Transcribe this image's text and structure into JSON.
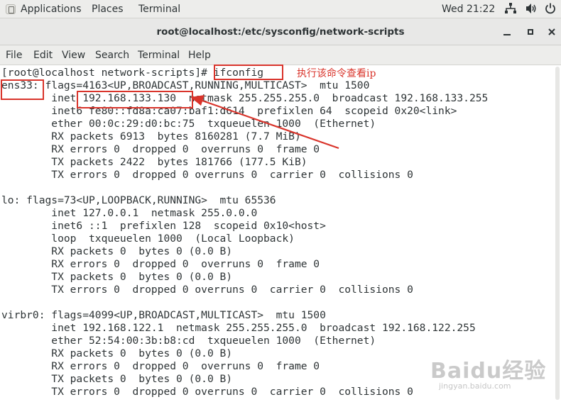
{
  "topbar": {
    "applications": "Applications",
    "places": "Places",
    "terminal": "Terminal",
    "clock": "Wed 21:22"
  },
  "window": {
    "title": "root@localhost:/etc/sysconfig/network-scripts"
  },
  "menu": {
    "file": "File",
    "edit": "Edit",
    "view": "View",
    "search": "Search",
    "terminal": "Terminal",
    "help": "Help"
  },
  "terminal": {
    "lines": [
      "[root@localhost network-scripts]# ifconfig",
      "ens33: flags=4163<UP,BROADCAST,RUNNING,MULTICAST>  mtu 1500",
      "        inet 192.168.133.130  netmask 255.255.255.0  broadcast 192.168.133.255",
      "        inet6 fe80::fd8a:ca07:baf1:d614  prefixlen 64  scopeid 0x20<link>",
      "        ether 00:0c:29:d0:bc:75  txqueuelen 1000  (Ethernet)",
      "        RX packets 6913  bytes 8160281 (7.7 MiB)",
      "        RX errors 0  dropped 0  overruns 0  frame 0",
      "        TX packets 2422  bytes 181766 (177.5 KiB)",
      "        TX errors 0  dropped 0 overruns 0  carrier 0  collisions 0",
      "",
      "lo: flags=73<UP,LOOPBACK,RUNNING>  mtu 65536",
      "        inet 127.0.0.1  netmask 255.0.0.0",
      "        inet6 ::1  prefixlen 128  scopeid 0x10<host>",
      "        loop  txqueuelen 1000  (Local Loopback)",
      "        RX packets 0  bytes 0 (0.0 B)",
      "        RX errors 0  dropped 0  overruns 0  frame 0",
      "        TX packets 0  bytes 0 (0.0 B)",
      "        TX errors 0  dropped 0 overruns 0  carrier 0  collisions 0",
      "",
      "virbr0: flags=4099<UP,BROADCAST,MULTICAST>  mtu 1500",
      "        inet 192.168.122.1  netmask 255.255.255.0  broadcast 192.168.122.255",
      "        ether 52:54:00:3b:b8:cd  txqueuelen 1000  (Ethernet)",
      "        RX packets 0  bytes 0 (0.0 B)",
      "        RX errors 0  dropped 0  overruns 0  frame 0",
      "        TX packets 0  bytes 0 (0.0 B)",
      "        TX errors 0  dropped 0 overruns 0  carrier 0  collisions 0"
    ]
  },
  "annotation": {
    "note": "执行该命令查看ip",
    "color": "#d9342b"
  },
  "watermark": {
    "brand": "Baidu经验",
    "url": "jingyan.baidu.com"
  },
  "icons": [
    "apps-icon",
    "network-icon",
    "volume-icon",
    "power-icon",
    "minimize-icon",
    "maximize-icon",
    "close-icon"
  ]
}
